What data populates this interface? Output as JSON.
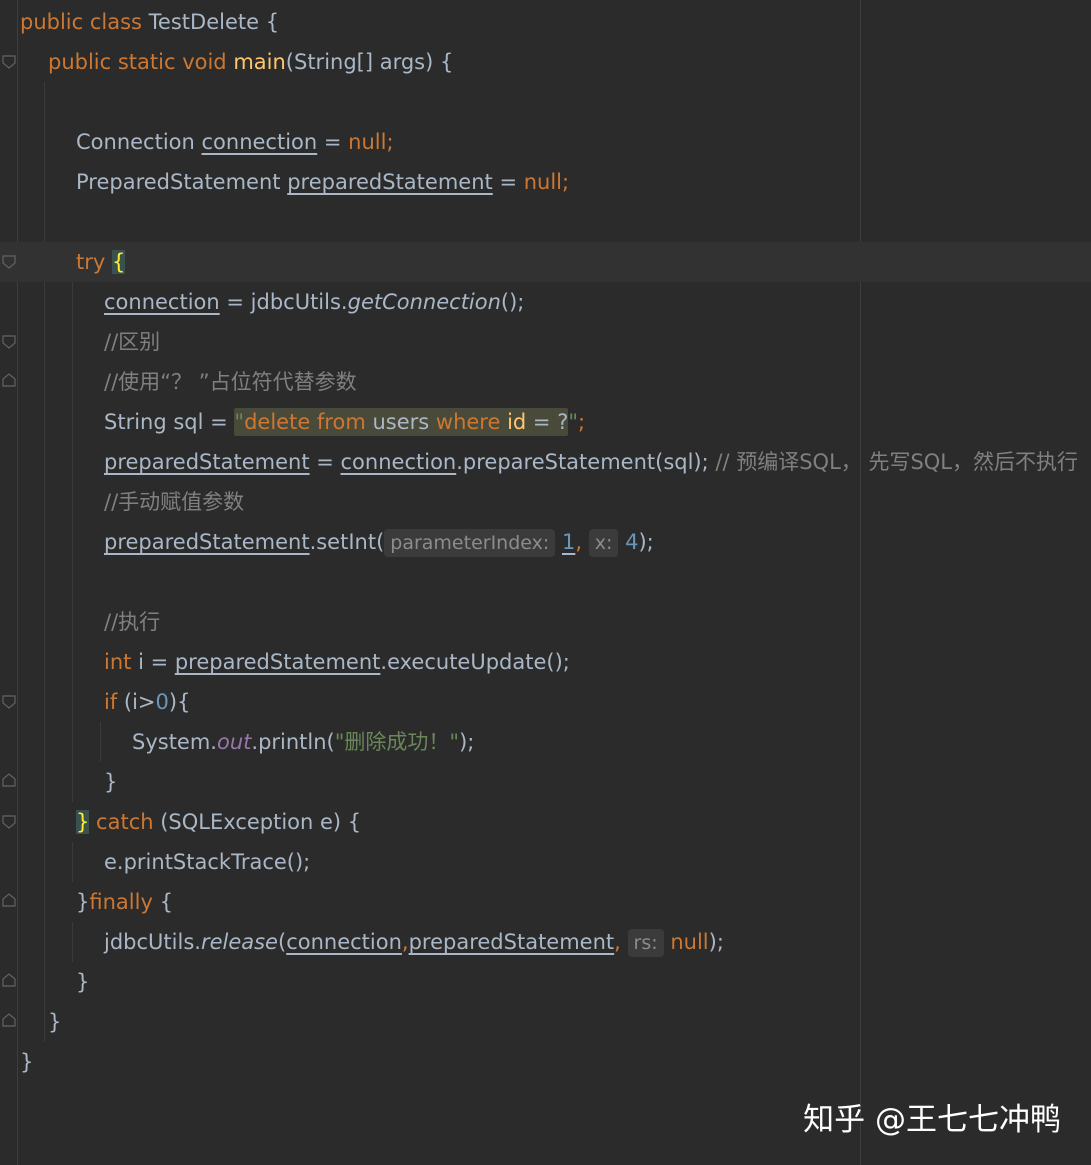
{
  "editor": {
    "lines": [
      [
        "public class ",
        "TestDelete {"
      ],
      [
        "public static void ",
        "main",
        "(String[] args) {"
      ],
      [],
      [
        "Connection ",
        "connection",
        " = ",
        "null;"
      ],
      [
        "PreparedStatement ",
        "preparedStatement",
        " = ",
        "null;"
      ],
      [],
      [
        "try ",
        "{"
      ],
      [
        "connection",
        " = jdbcUtils.",
        "getConnection",
        "();"
      ],
      [
        "//区别"
      ],
      [
        "//使用“？ ”占位符代替参数"
      ],
      [
        "String sql = ",
        "\"",
        "delete from ",
        "users ",
        "where ",
        "id",
        " = ?",
        "\"",
        ";"
      ],
      [
        "preparedStatement",
        " = ",
        "connection",
        ".prepareStatement(sql);",
        " // 预编译SQL， 先写SQL，然后不执行"
      ],
      [
        "//手动赋值参数"
      ],
      [
        "preparedStatement",
        ".setInt(",
        "parameterIndex:",
        "1",
        ",",
        "x:",
        "4",
        ");"
      ],
      [],
      [
        "//执行"
      ],
      [
        "int ",
        "i = ",
        "preparedStatement",
        ".executeUpdate();"
      ],
      [
        "if ",
        "(i>",
        "0",
        "){"
      ],
      [
        "System.",
        "out",
        ".println(",
        "\"删除成功！\"",
        ");"
      ],
      [
        "}"
      ],
      [
        "}",
        " catch ",
        "(SQLException e) {"
      ],
      [
        "e.printStackTrace();"
      ],
      [
        "}",
        "finally ",
        "{"
      ],
      [
        "jdbcUtils.",
        "release",
        "(",
        "connection",
        ",",
        "preparedStatement",
        ",",
        "rs:",
        "null",
        ");"
      ],
      [
        "}"
      ],
      [
        "}"
      ],
      [
        "}"
      ]
    ]
  },
  "watermark": {
    "text": "知乎 @王七七冲鸭"
  },
  "colors": {
    "background": "#2b2b2b",
    "keyword": "#cc7832",
    "string": "#6a8759",
    "number": "#6897bb",
    "comment": "#808080",
    "method": "#ffc66d",
    "field": "#9876aa"
  }
}
